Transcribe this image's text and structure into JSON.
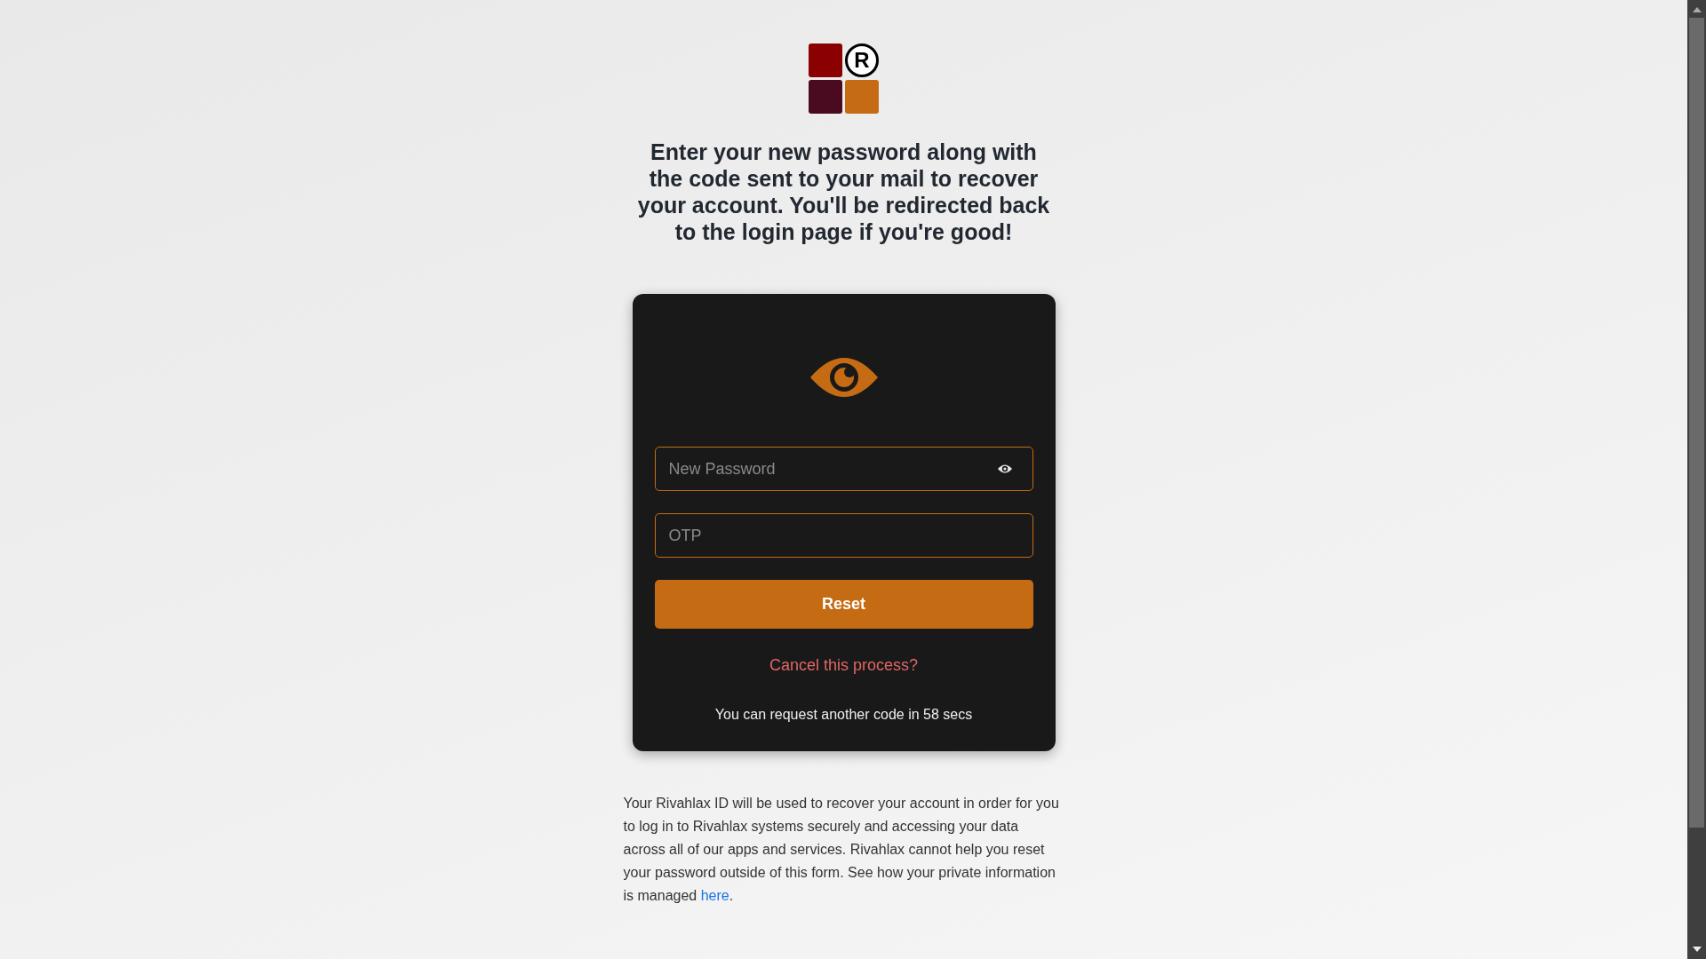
{
  "logo": {
    "mark": "R"
  },
  "heading": "Enter your new password along with the code sent to your mail to recover your account. You'll be redirected back to the login page if you're good!",
  "form": {
    "fields": [
      {
        "kind": "password",
        "placeholder": "New Password"
      },
      {
        "kind": "text",
        "placeholder": "OTP"
      }
    ],
    "submit": "Reset",
    "cancel_link": "Cancel this process?",
    "countdown": "You can request another code in 58 secs"
  },
  "note": {
    "text": "Your Rivahlax ID will be used to recover your account in order for you to log in to Rivahlax systems securely and accessing your data across all of our apps and services. Rivahlax cannot help you reset your password outside of this form. See how your private information is managed ",
    "link": "here",
    "end": "."
  }
}
